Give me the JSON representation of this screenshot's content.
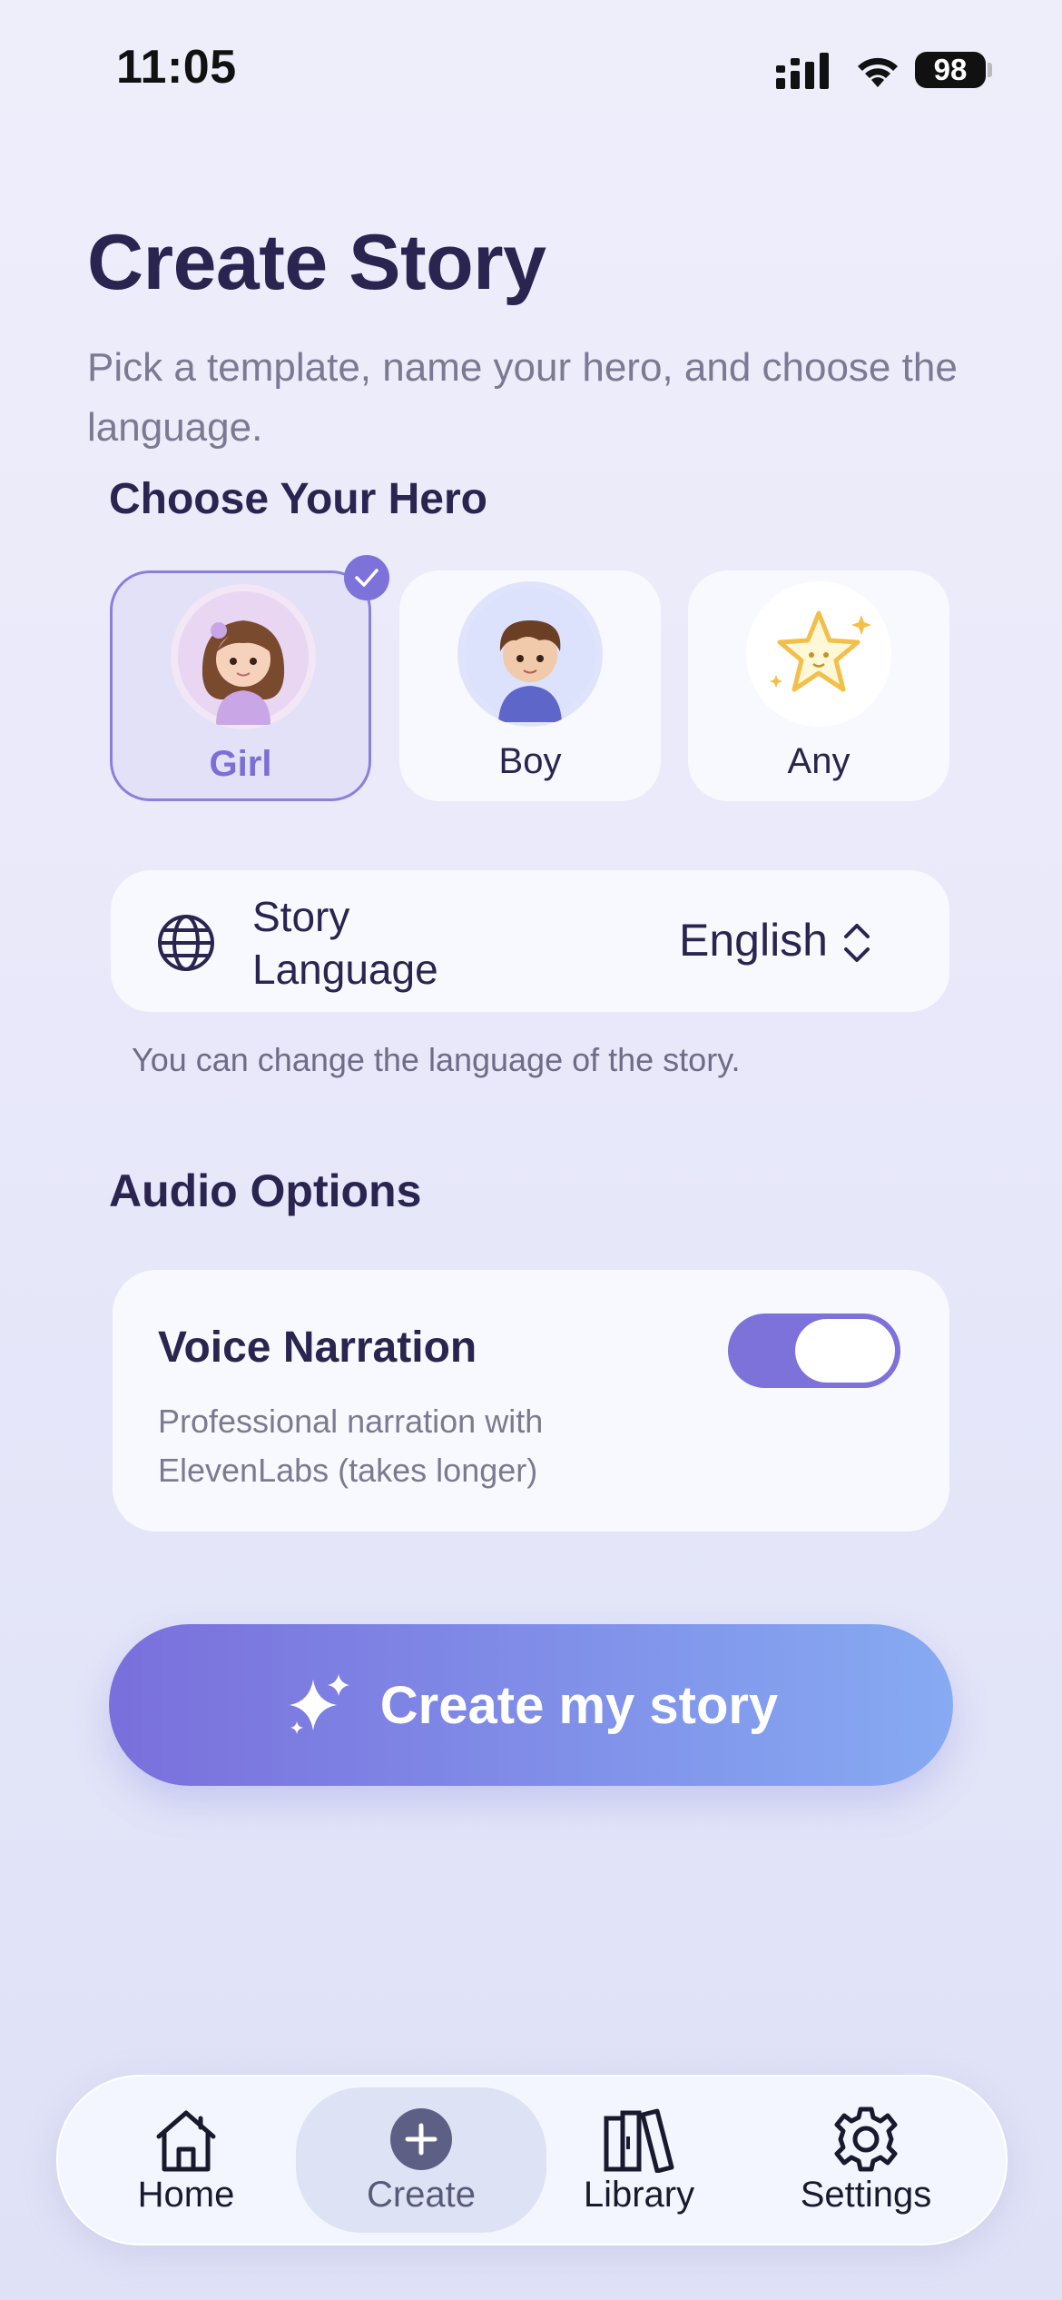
{
  "status_bar": {
    "time": "11:05",
    "battery": "98"
  },
  "header": {
    "title": "Create Story",
    "subtitle": "Pick a template, name your hero, and choose the language."
  },
  "hero_section": {
    "heading": "Choose Your Hero",
    "options": [
      {
        "label": "Girl",
        "selected": true,
        "icon": "girl-avatar-icon"
      },
      {
        "label": "Boy",
        "selected": false,
        "icon": "boy-avatar-icon"
      },
      {
        "label": "Any",
        "selected": false,
        "icon": "star-icon"
      }
    ]
  },
  "language": {
    "label": "Story Language",
    "value": "English",
    "hint": "You can change the language of the story.",
    "icon": "globe-icon"
  },
  "audio": {
    "heading": "Audio Options",
    "voice_title": "Voice Narration",
    "voice_desc": "Professional narration with ElevenLabs (takes longer)",
    "enabled": true
  },
  "cta": {
    "label": "Create my story",
    "icon": "sparkles-icon"
  },
  "tabbar": {
    "items": [
      {
        "label": "Home",
        "icon": "home-icon",
        "active": false
      },
      {
        "label": "Create",
        "icon": "plus-circle-icon",
        "active": true
      },
      {
        "label": "Library",
        "icon": "books-icon",
        "active": false
      },
      {
        "label": "Settings",
        "icon": "gear-icon",
        "active": false
      }
    ]
  },
  "colors": {
    "accent": "#7d71da",
    "title": "#2a2450",
    "card": "#f8f9fe"
  }
}
